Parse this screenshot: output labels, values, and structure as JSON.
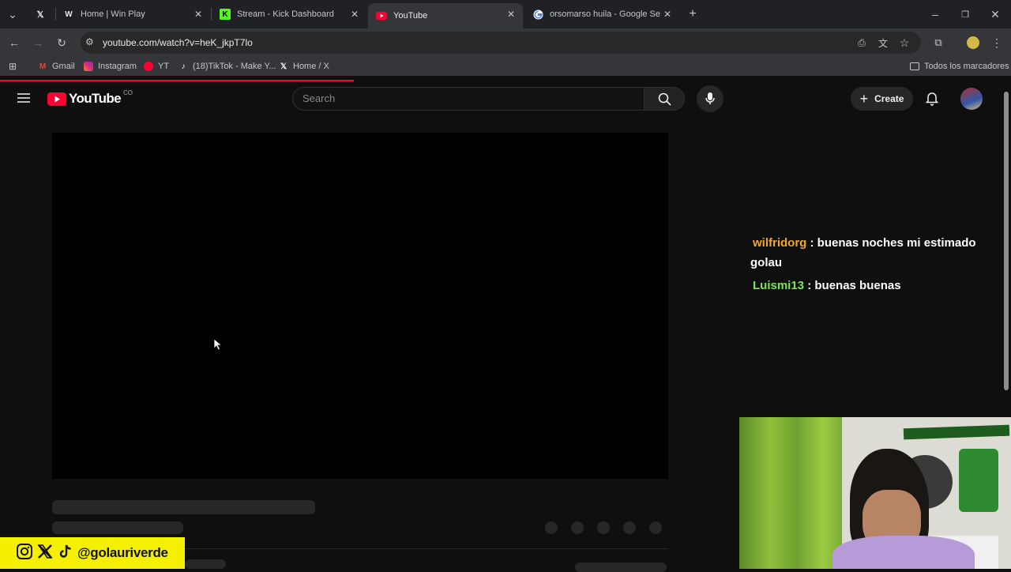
{
  "browser": {
    "tabs": [
      {
        "title": "",
        "icon": "x-logo-icon"
      },
      {
        "title": "Home | Win Play",
        "icon": "winplay-icon"
      },
      {
        "title": "Stream - Kick Dashboard",
        "icon": "kick-icon"
      },
      {
        "title": "YouTube",
        "icon": "youtube-icon",
        "active": true
      },
      {
        "title": "orsomarso huila - Google Searc",
        "icon": "google-icon"
      }
    ],
    "url": "youtube.com/watch?v=heK_jkpT7lo",
    "bookmarks": [
      {
        "label": "Gmail",
        "icon": "gmail-icon"
      },
      {
        "label": "Instagram",
        "icon": "instagram-icon"
      },
      {
        "label": "YT",
        "icon": "youtube-icon"
      },
      {
        "label": "(18)TikTok - Make Y...",
        "icon": "tiktok-icon"
      },
      {
        "label": "Home / X",
        "icon": "x-logo-icon"
      }
    ],
    "all_bookmarks": "Todos los marcadores"
  },
  "youtube": {
    "logo_text": "YouTube",
    "country_code": "CO",
    "search_placeholder": "Search",
    "create_label": "Create",
    "accent": "#ff0033"
  },
  "chat": [
    {
      "user": "wilfridorg",
      "message": ": buenas noches mi estimado golau",
      "color": "#f5a623"
    },
    {
      "user": "Luismi13",
      "message": ": buenas buenas",
      "color": "#7ee35a"
    }
  ],
  "overlay": {
    "handle": "@golauriverde"
  }
}
